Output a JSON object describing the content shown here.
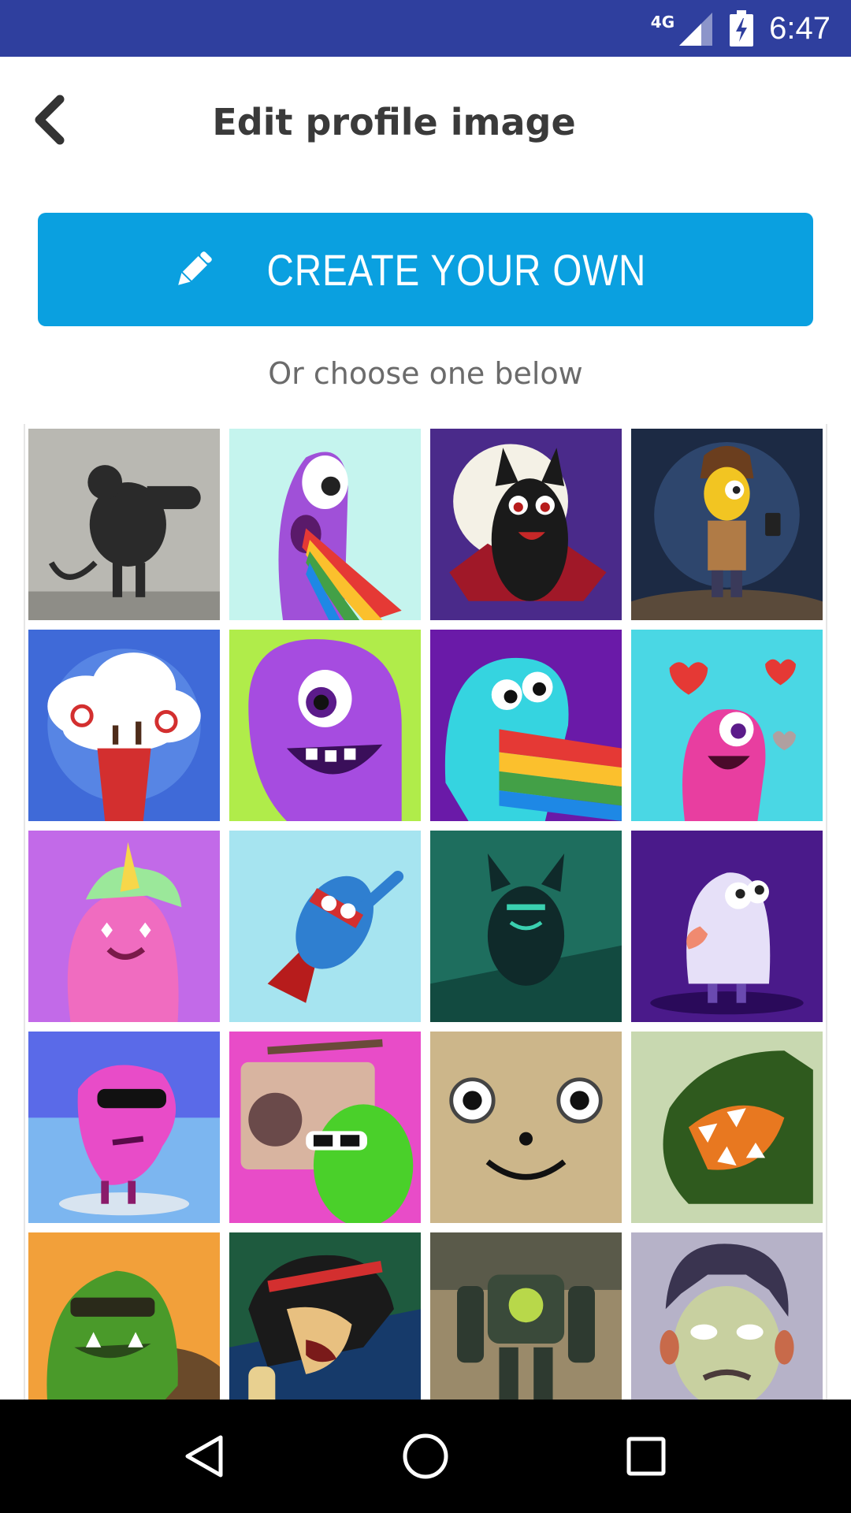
{
  "status_bar": {
    "network": "4G",
    "time": "6:47",
    "background_color": "#2f3f9e"
  },
  "header": {
    "title": "Edit profile image",
    "back_icon": "chevron-left-icon"
  },
  "create_button": {
    "label": "CREATE YOUR OWN",
    "icon": "pencil-icon",
    "color": "#0aa0e0"
  },
  "subtitle": "Or choose one below",
  "avatars": [
    {
      "name": "avatar-rat-graffiti"
    },
    {
      "name": "avatar-purple-rainbow-monster"
    },
    {
      "name": "avatar-vampire-bat"
    },
    {
      "name": "avatar-selfie-guy"
    },
    {
      "name": "avatar-exploding-cupcake"
    },
    {
      "name": "avatar-purple-blob"
    },
    {
      "name": "avatar-cyan-rainbow-monster"
    },
    {
      "name": "avatar-pink-love-monster"
    },
    {
      "name": "avatar-pink-unicorn"
    },
    {
      "name": "avatar-flying-hero"
    },
    {
      "name": "avatar-green-goblin"
    },
    {
      "name": "avatar-tongue-ghost"
    },
    {
      "name": "avatar-cool-pink-bean"
    },
    {
      "name": "avatar-boombox-green"
    },
    {
      "name": "avatar-smiley-face"
    },
    {
      "name": "avatar-green-dragon"
    },
    {
      "name": "avatar-green-ogre"
    },
    {
      "name": "avatar-singer"
    },
    {
      "name": "avatar-robot"
    },
    {
      "name": "avatar-gorillaz-guy"
    }
  ],
  "nav_bar": {
    "back": "triangle-back-icon",
    "home": "circle-home-icon",
    "recents": "square-recents-icon"
  }
}
